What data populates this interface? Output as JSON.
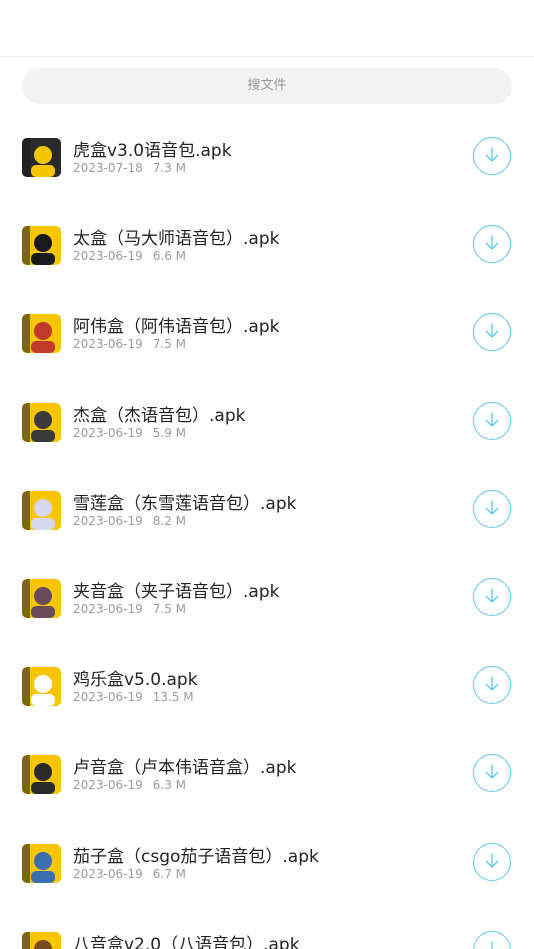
{
  "search": {
    "placeholder": "搜文件"
  },
  "files": [
    {
      "name": "虎盒v3.0语音包.apk",
      "date": "2023-07-18",
      "size": "7.3 M",
      "thumb_bg": "#2a2a2a",
      "thumb_accent": "#f7c600"
    },
    {
      "name": "太盒（马大师语音包）.apk",
      "date": "2023-06-19",
      "size": "6.6 M",
      "thumb_bg": "#f7c600",
      "thumb_accent": "#1a1a1a"
    },
    {
      "name": "阿伟盒（阿伟语音包）.apk",
      "date": "2023-06-19",
      "size": "7.5 M",
      "thumb_bg": "#f7c600",
      "thumb_accent": "#c0392b"
    },
    {
      "name": "杰盒（杰语音包）.apk",
      "date": "2023-06-19",
      "size": "5.9 M",
      "thumb_bg": "#f7c600",
      "thumb_accent": "#3a3a3a"
    },
    {
      "name": "雪莲盒（东雪莲语音包）.apk",
      "date": "2023-06-19",
      "size": "8.2 M",
      "thumb_bg": "#f7c600",
      "thumb_accent": "#d8d8ee"
    },
    {
      "name": "夹音盒（夹子语音包）.apk",
      "date": "2023-06-19",
      "size": "7.5 M",
      "thumb_bg": "#f7c600",
      "thumb_accent": "#6b4a5a"
    },
    {
      "name": "鸡乐盒v5.0.apk",
      "date": "2023-06-19",
      "size": "13.5 M",
      "thumb_bg": "#f7c600",
      "thumb_accent": "#ffffff"
    },
    {
      "name": "卢音盒（卢本伟语音盒）.apk",
      "date": "2023-06-19",
      "size": "6.3 M",
      "thumb_bg": "#f7c600",
      "thumb_accent": "#2a2a2a"
    },
    {
      "name": "茄子盒（csgo茄子语音包）.apk",
      "date": "2023-06-19",
      "size": "6.7 M",
      "thumb_bg": "#f7c600",
      "thumb_accent": "#3b6fb0"
    },
    {
      "name": "八音盒v2.0（八语音包）.apk",
      "date": "",
      "size": "",
      "thumb_bg": "#f7c600",
      "thumb_accent": "#7a4a20"
    }
  ],
  "icons": {
    "download": "download-icon"
  },
  "colors": {
    "accent": "#5cc7ea",
    "text": "#222222",
    "meta": "#9b9b9b"
  }
}
